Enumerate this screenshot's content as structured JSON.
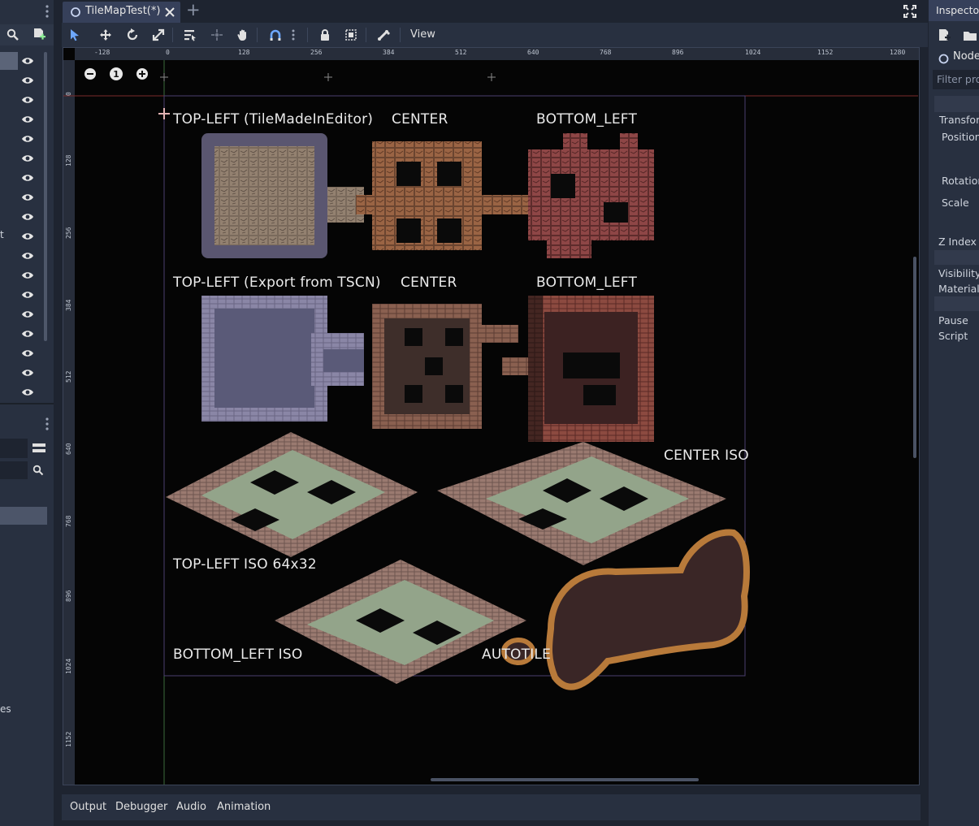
{
  "scene_tab": {
    "title": "TileMapTest(*)",
    "add_label": "+"
  },
  "toolbar": {
    "view_label": "View"
  },
  "ruler": {
    "top": [
      "-128",
      "0",
      "128",
      "256",
      "384",
      "512",
      "640",
      "768",
      "896",
      "1024",
      "1152",
      "1280"
    ],
    "left": [
      "0",
      "128",
      "256",
      "384",
      "512",
      "640",
      "768",
      "896",
      "1024",
      "1152"
    ]
  },
  "zoom": {
    "reset_label": "1"
  },
  "labels": {
    "tl_editor": "TOP-LEFT (TileMadeInEditor)",
    "center1": "CENTER",
    "bottom_left1": "BOTTOM_LEFT",
    "tl_export": "TOP-LEFT (Export from TSCN)",
    "center2": "CENTER",
    "bottom_left2": "BOTTOM_LEFT",
    "center_iso": "CENTER ISO",
    "tl_iso": "TOP-LEFT ISO 64x32",
    "bottom_left_iso": "BOTTOM_LEFT ISO",
    "autotile": "AUTOTILE"
  },
  "left_dock": {
    "frag1": "t",
    "frag2": "es"
  },
  "bottom_tabs": [
    "Output",
    "Debugger",
    "Audio",
    "Animation"
  ],
  "inspector": {
    "title": "Inspecto",
    "node_label": "Node",
    "filter_placeholder": "Filter pro",
    "items": [
      "Transfor",
      "Position",
      "Rotation",
      "Scale",
      "Z Index",
      "Visibility",
      "Material",
      "Pause",
      "Script"
    ]
  }
}
